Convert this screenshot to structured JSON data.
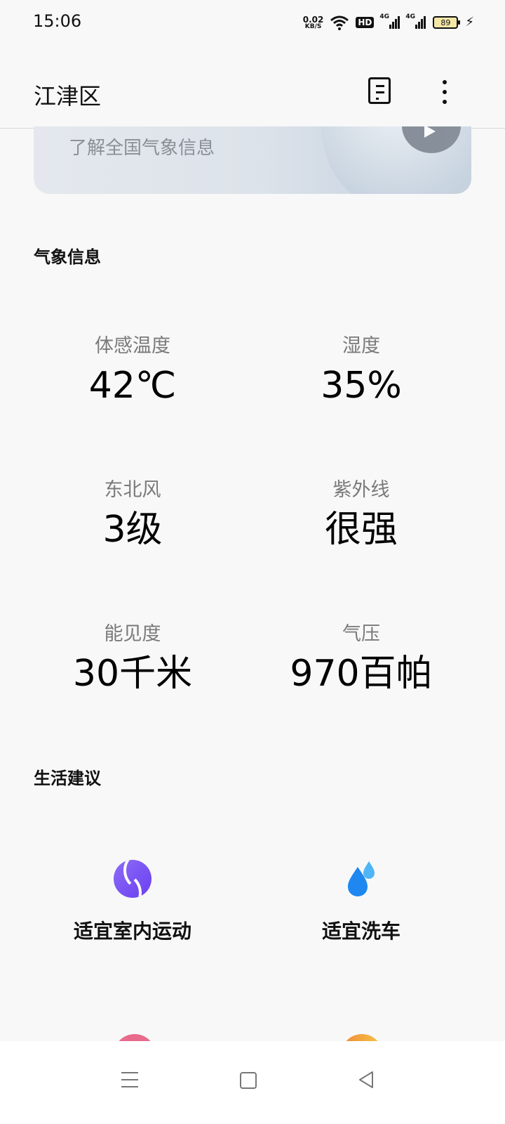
{
  "status_bar": {
    "time": "15:06",
    "net_speed_value": "0.02",
    "net_speed_unit": "KB/S",
    "hd_label": "HD",
    "signal1_label": "4G",
    "signal2_label": "4G",
    "battery_level": "89"
  },
  "app_bar": {
    "title": "江津区",
    "list_icon": "list-icon",
    "more_icon": "more-vertical-icon"
  },
  "banner": {
    "text": "了解全国气象信息",
    "play_icon": "play-icon"
  },
  "weather_info": {
    "section_title": "气象信息",
    "items": [
      {
        "label": "体感温度",
        "value": "42℃"
      },
      {
        "label": "湿度",
        "value": "35%"
      },
      {
        "label": "东北风",
        "value": "3级"
      },
      {
        "label": "紫外线",
        "value": "很强"
      },
      {
        "label": "能见度",
        "value": "30千米"
      },
      {
        "label": "气压",
        "value": "970百帕"
      }
    ]
  },
  "life_advice": {
    "section_title": "生活建议",
    "items": [
      {
        "icon": "sport-ball-icon",
        "text": "适宜室内运动",
        "color": "#7b54f3"
      },
      {
        "icon": "water-drop-icon",
        "text": "适宜洗车",
        "color": "#1e88f0"
      }
    ]
  },
  "nav_bar": {
    "menu_icon": "menu-icon",
    "home_icon": "home-icon",
    "back_icon": "back-icon"
  }
}
